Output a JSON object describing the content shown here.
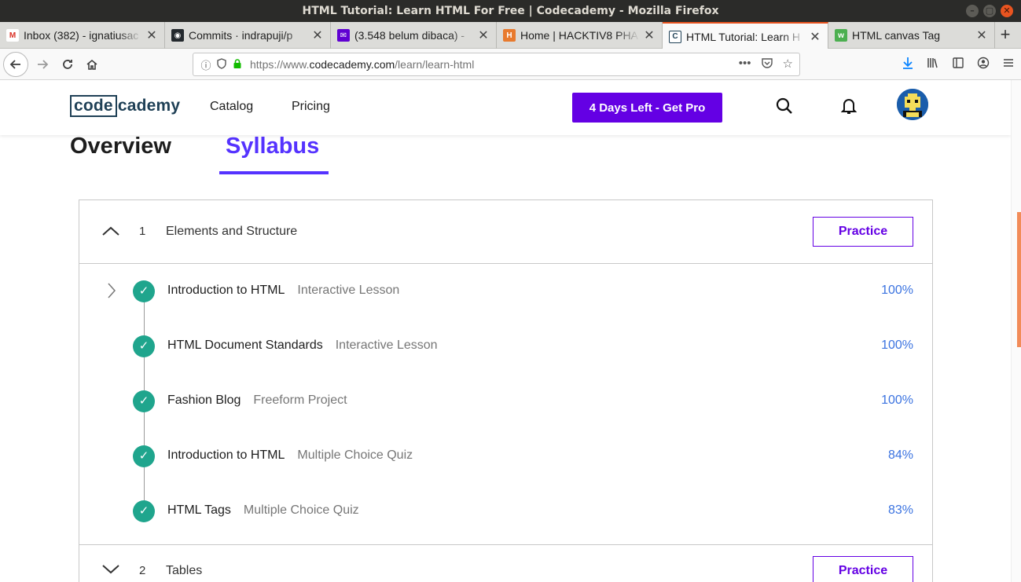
{
  "window": {
    "title": "HTML Tutorial: Learn HTML For Free | Codecademy - Mozilla Firefox",
    "controls": [
      "–",
      "▢",
      "✕"
    ]
  },
  "tabs": [
    {
      "label": "Inbox (382) - ignatiusac",
      "icon": "gmail-icon",
      "icon_color": "#d93025",
      "glyph": "M"
    },
    {
      "label": "Commits · indrapuji/p",
      "icon": "github-icon",
      "icon_color": "#24292e",
      "glyph": "◉"
    },
    {
      "label": "(3.548 belum dibaca) -",
      "icon": "yahoo-mail-icon",
      "icon_color": "#6001d2",
      "glyph": "✉"
    },
    {
      "label": "Home | HACKTIV8 PHA",
      "icon": "hacktiv8-icon",
      "icon_color": "#e87a2e",
      "glyph": "H"
    },
    {
      "label": "HTML Tutorial: Learn H",
      "icon": "codecademy-icon",
      "icon_color": "#1f4056",
      "glyph": "C",
      "active": true
    },
    {
      "label": "HTML canvas Tag",
      "icon": "w3schools-icon",
      "icon_color": "#4caf50",
      "glyph": "w"
    }
  ],
  "navbar": {
    "url_prefix": "https://www.",
    "url_domain": "codecademy.com",
    "url_path": "/learn/learn-html"
  },
  "site": {
    "logo_box": "code",
    "logo_rest": "cademy",
    "nav": [
      "Catalog",
      "Pricing"
    ],
    "cta": "4 Days Left - Get Pro"
  },
  "page_tabs": {
    "overview": "Overview",
    "syllabus": "Syllabus"
  },
  "modules": [
    {
      "number": "1",
      "title": "Elements and Structure",
      "practice": "Practice",
      "expanded": true,
      "lessons": [
        {
          "name": "Introduction to HTML",
          "type": "Interactive Lesson",
          "progress": "100%"
        },
        {
          "name": "HTML Document Standards",
          "type": "Interactive Lesson",
          "progress": "100%"
        },
        {
          "name": "Fashion Blog",
          "type": "Freeform Project",
          "progress": "100%"
        },
        {
          "name": "Introduction to HTML",
          "type": "Multiple Choice Quiz",
          "progress": "84%"
        },
        {
          "name": "HTML Tags",
          "type": "Multiple Choice Quiz",
          "progress": "83%"
        }
      ]
    },
    {
      "number": "2",
      "title": "Tables",
      "practice": "Practice",
      "expanded": false
    }
  ],
  "colors": {
    "brand_purple": "#6400e4",
    "syllabus_accent": "#5533ff",
    "check_green": "#1fa58d",
    "progress_blue": "#3b73e0",
    "firefox_accent": "#e95420"
  }
}
